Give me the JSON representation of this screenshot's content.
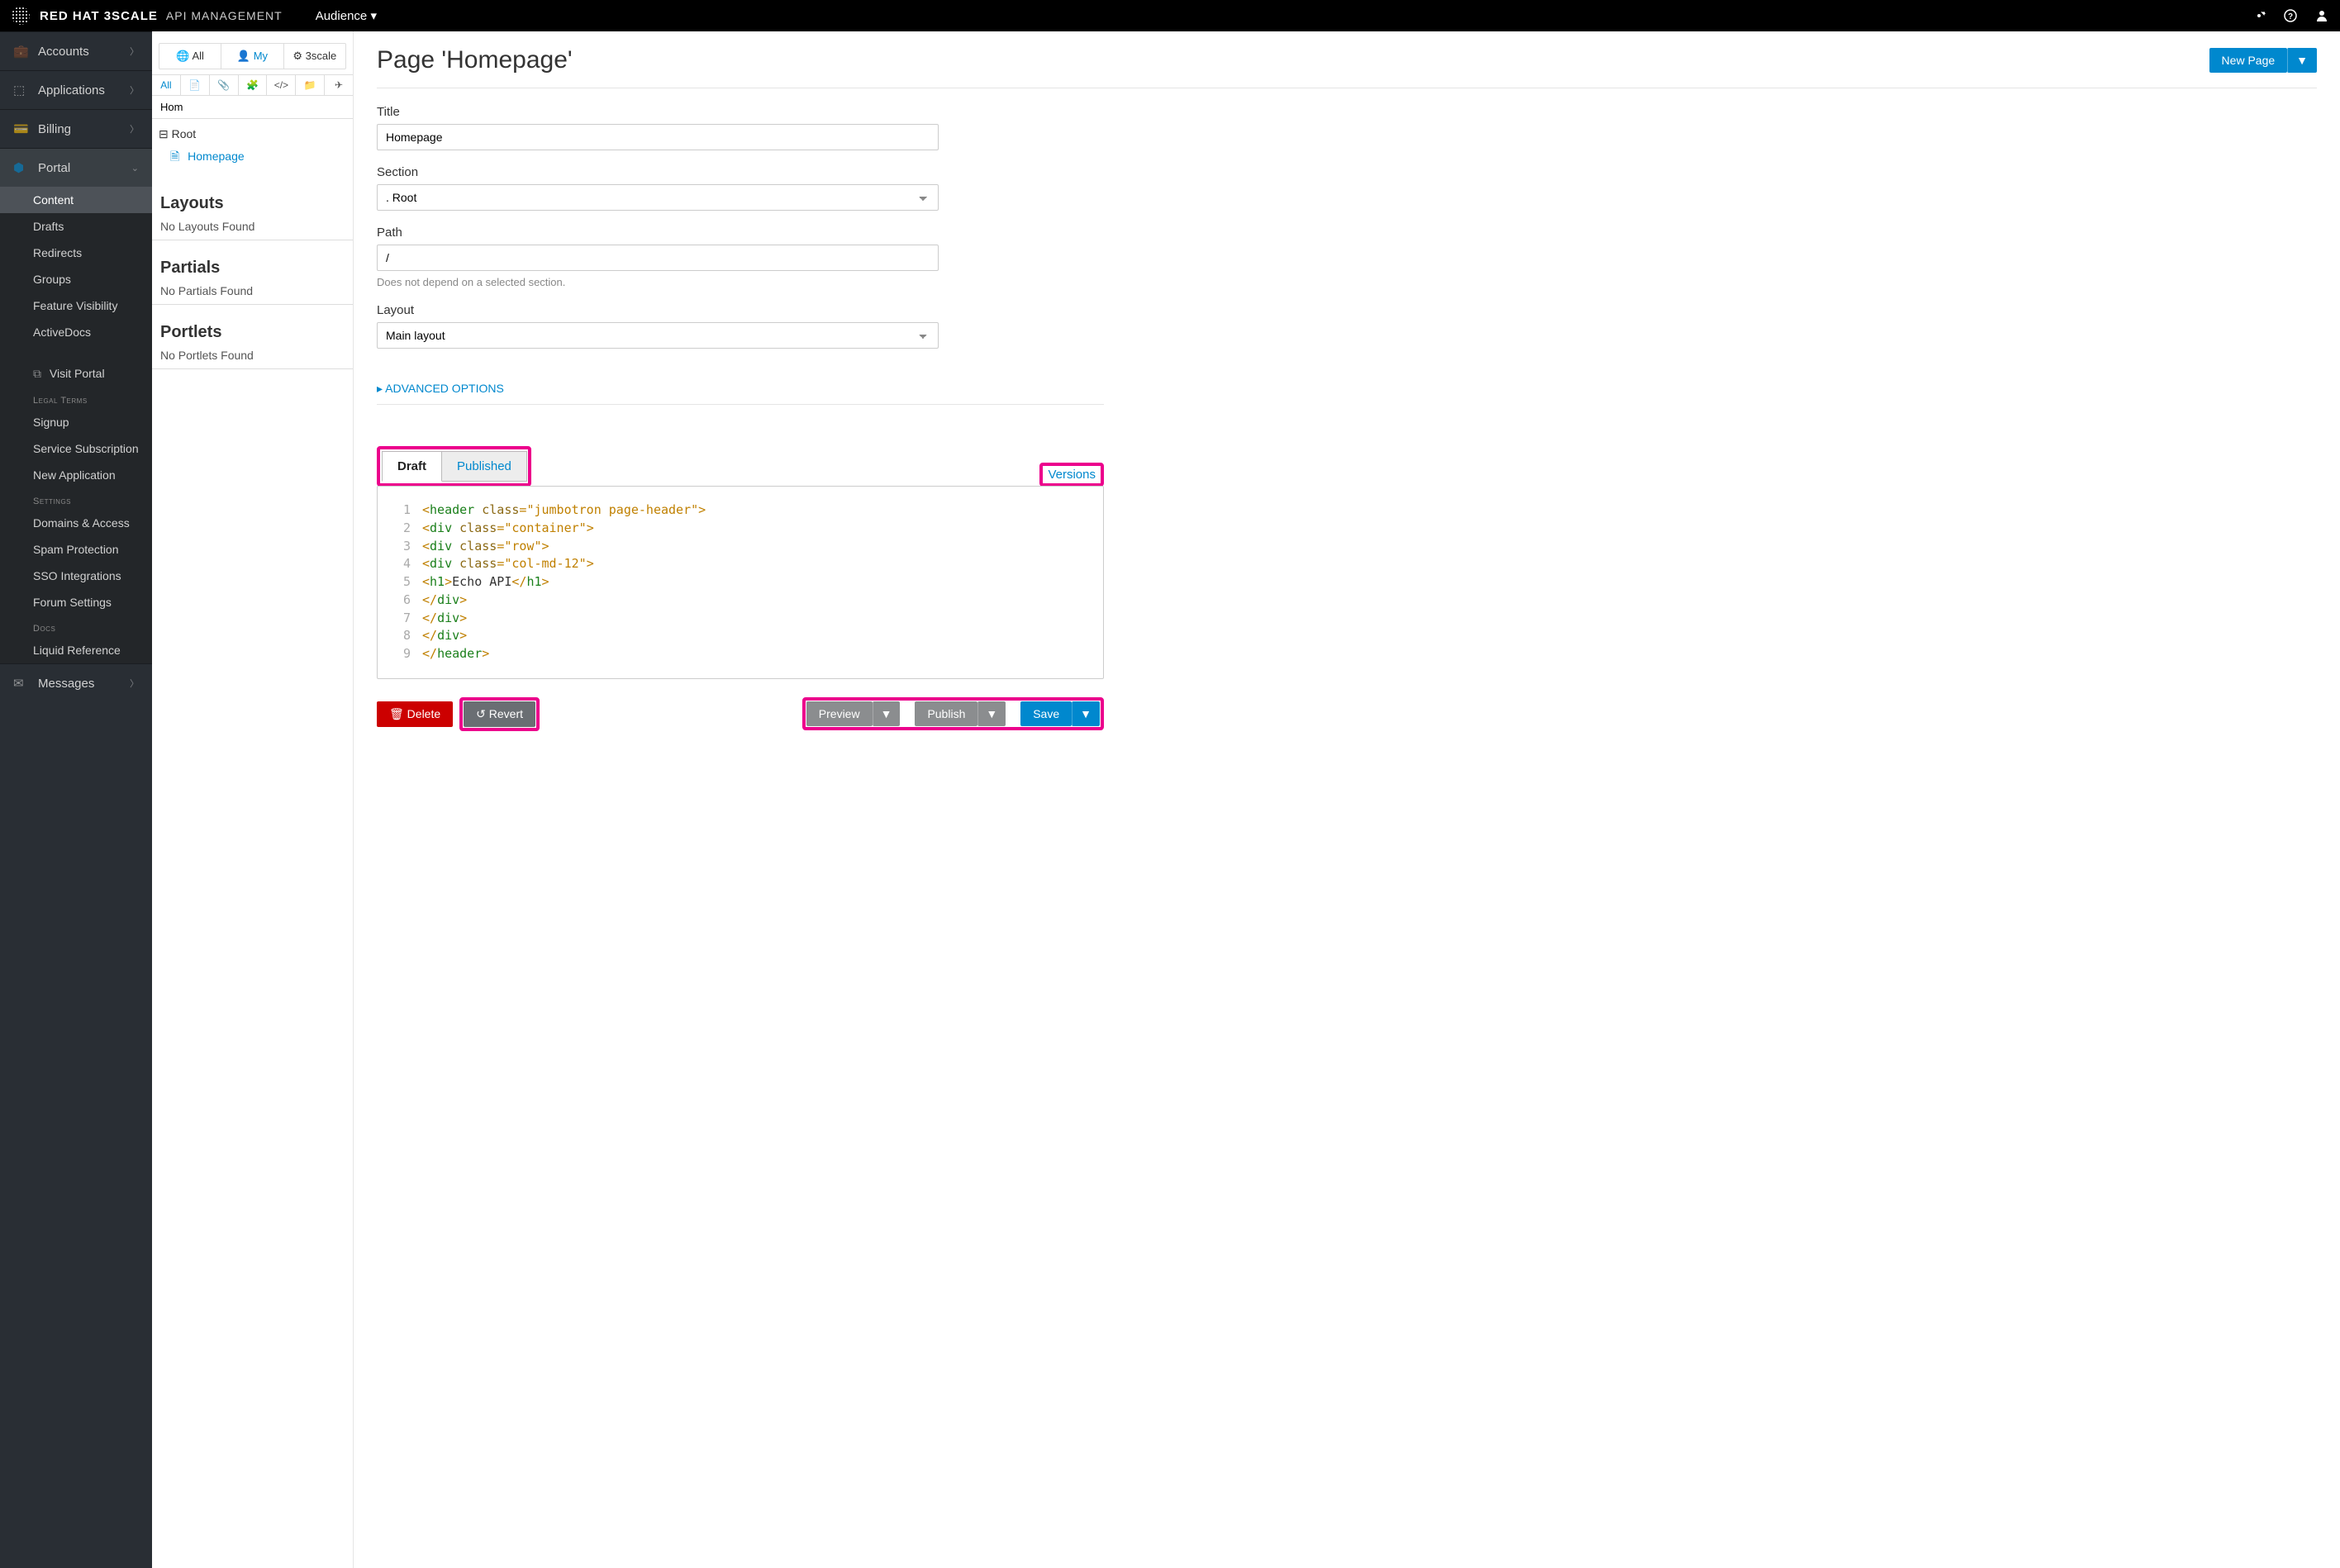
{
  "topbar": {
    "brand_bold": "RED HAT 3SCALE",
    "brand_light": "API MANAGEMENT",
    "audience_label": "Audience"
  },
  "sidebar": {
    "accounts": "Accounts",
    "applications": "Applications",
    "billing": "Billing",
    "portal": "Portal",
    "messages": "Messages",
    "portal_items": {
      "content": "Content",
      "drafts": "Drafts",
      "redirects": "Redirects",
      "groups": "Groups",
      "feature_visibility": "Feature Visibility",
      "activedocs": "ActiveDocs",
      "visit_portal": "Visit Portal"
    },
    "legal_heading": "Legal Terms",
    "legal": {
      "signup": "Signup",
      "service_sub": "Service Subscription",
      "new_app": "New Application"
    },
    "settings_heading": "Settings",
    "settings": {
      "domains": "Domains & Access",
      "spam": "Spam Protection",
      "sso": "SSO Integrations",
      "forum": "Forum Settings"
    },
    "docs_heading": "Docs",
    "docs": {
      "liquid": "Liquid Reference"
    }
  },
  "cms": {
    "tabs": {
      "all": "All",
      "my": "My",
      "scale": "3scale"
    },
    "filters": {
      "all": "All"
    },
    "search_value": "Hom",
    "tree": {
      "root": "Root",
      "homepage": "Homepage"
    },
    "sections": {
      "layouts_h": "Layouts",
      "layouts_empty": "No Layouts Found",
      "partials_h": "Partials",
      "partials_empty": "No Partials Found",
      "portlets_h": "Portlets",
      "portlets_empty": "No Portlets Found"
    }
  },
  "page": {
    "heading": "Page 'Homepage'",
    "new_page": "New Page",
    "form": {
      "title_label": "Title",
      "title_value": "Homepage",
      "section_label": "Section",
      "section_value": ". Root",
      "path_label": "Path",
      "path_value": "/",
      "path_help": "Does not depend on a selected section.",
      "layout_label": "Layout",
      "layout_value": "Main layout"
    },
    "advanced": "ADVANCED OPTIONS",
    "editor_tabs": {
      "draft": "Draft",
      "published": "Published",
      "versions": "Versions"
    },
    "code_lines": [
      {
        "n": "1",
        "indent": 0,
        "open": true,
        "tag": "header",
        "attr": "class",
        "val": "jumbotron page-header"
      },
      {
        "n": "2",
        "indent": 1,
        "open": true,
        "tag": "div",
        "attr": "class",
        "val": "container"
      },
      {
        "n": "3",
        "indent": 2,
        "open": true,
        "tag": "div",
        "attr": "class",
        "val": "row"
      },
      {
        "n": "4",
        "indent": 3,
        "open": true,
        "tag": "div",
        "attr": "class",
        "val": "col-md-12"
      },
      {
        "n": "5",
        "indent": 4,
        "inline": true,
        "tag": "h1",
        "text": "Echo API"
      },
      {
        "n": "6",
        "indent": 3,
        "close": true,
        "tag": "div"
      },
      {
        "n": "7",
        "indent": 2,
        "close": true,
        "tag": "div"
      },
      {
        "n": "8",
        "indent": 1,
        "close": true,
        "tag": "div"
      },
      {
        "n": "9",
        "indent": 0,
        "close": true,
        "tag": "header"
      }
    ],
    "actions": {
      "delete": "Delete",
      "revert": "Revert",
      "preview": "Preview",
      "publish": "Publish",
      "save": "Save"
    }
  }
}
